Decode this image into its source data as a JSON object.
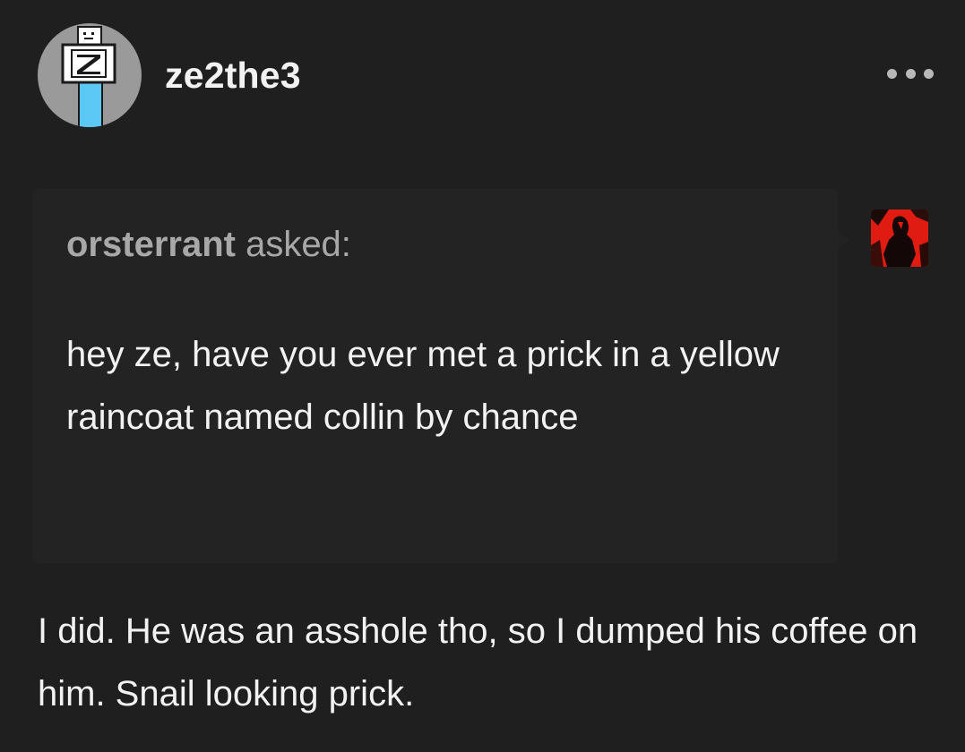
{
  "post": {
    "author": "ze2the3",
    "author_avatar_icon": "pixel-robot-z-avatar",
    "more_icon": "more-options-icon",
    "colors": {
      "background": "#1f1f1f",
      "ask_background": "#232323",
      "text": "#f2f2f2",
      "muted_text": "#a8a8a8",
      "avatar_bg": "#9a9a9a",
      "avatar_accent": "#5bc8f5",
      "asker_avatar_red": "#e01b12"
    }
  },
  "ask": {
    "asker": "orsterrant",
    "asked_label": " asked:",
    "question": "hey ze, have you ever met a prick in a yellow raincoat named collin by chance",
    "asker_avatar_icon": "red-silhouette-avatar"
  },
  "answer": {
    "text": "I did. He was an asshole tho, so I dumped his coffee on him. Snail looking prick."
  }
}
